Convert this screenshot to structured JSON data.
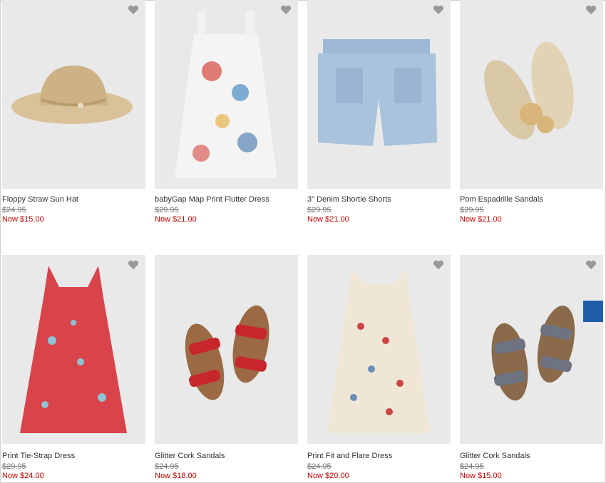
{
  "products": [
    {
      "name": "Floppy Straw Sun Hat",
      "was": "$24.95",
      "now": "Now $15.00",
      "image": "straw-hat"
    },
    {
      "name": "babyGap Map Print Flutter Dress",
      "was": "$29.95",
      "now": "Now $21.00",
      "image": "map-dress"
    },
    {
      "name": "3\" Denim Shortie Shorts",
      "was": "$29.95",
      "now": "Now $21.00",
      "image": "denim-shorts"
    },
    {
      "name": "Pom Espadrille Sandals",
      "was": "$29.95",
      "now": "Now $21.00",
      "image": "espadrille-sandals"
    },
    {
      "name": "Print Tie-Strap Dress",
      "was": "$29.95",
      "now": "Now $24.00",
      "image": "red-floral-dress"
    },
    {
      "name": "Glitter Cork Sandals",
      "was": "$24.95",
      "now": "Now $18.00",
      "image": "red-glitter-sandals"
    },
    {
      "name": "Print Fit and Flare Dress",
      "was": "$24.95",
      "now": "Now $20.00",
      "image": "print-flare-dress"
    },
    {
      "name": "Glitter Cork Sandals",
      "was": "$24.95",
      "now": "Now $15.00",
      "image": "silver-glitter-sandals"
    }
  ],
  "icons": {
    "favorite": "heart-icon"
  },
  "colors": {
    "sale_price": "#d40000",
    "badge": "#1f5ea8",
    "image_bg": "#e9e9e9"
  }
}
